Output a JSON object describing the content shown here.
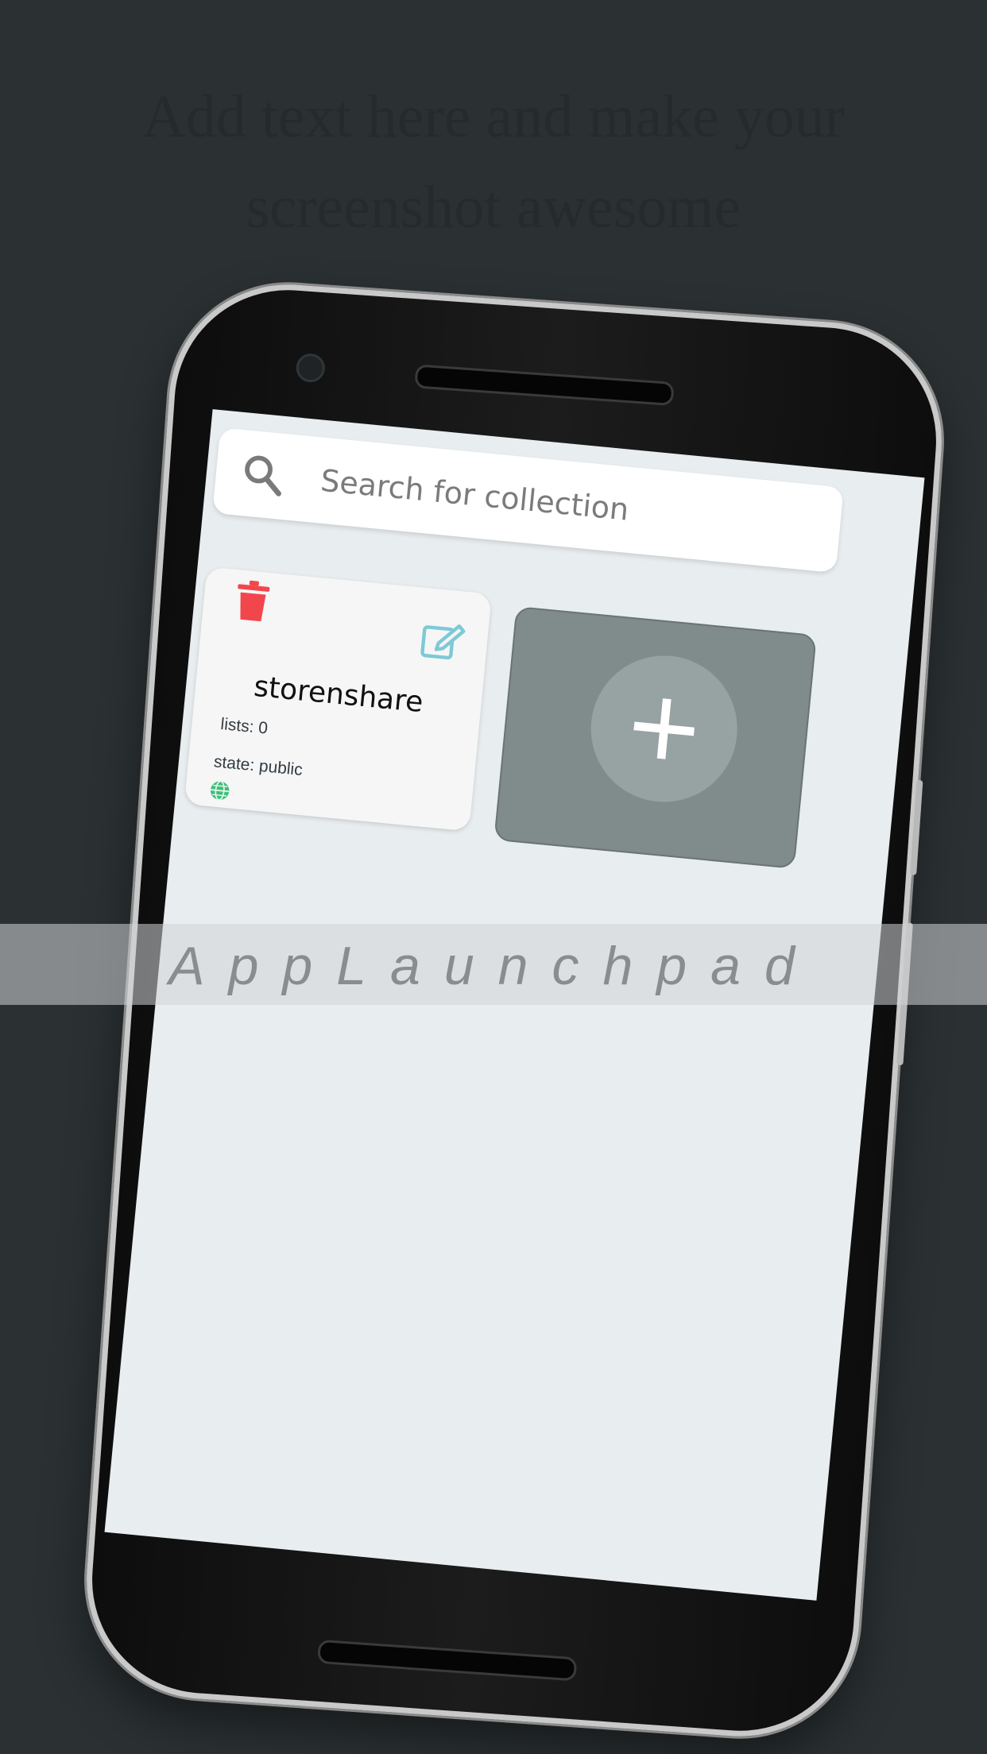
{
  "headline": {
    "line1": "Add text here and make your",
    "line2": "screenshot awesome"
  },
  "search": {
    "placeholder": "Search for collection",
    "icon": "search-icon"
  },
  "collections": [
    {
      "title": "storenshare",
      "lists": "lists: 0",
      "state": "state: public",
      "icons": [
        "trash-icon",
        "edit-icon",
        "globe-icon"
      ]
    }
  ],
  "add_tile": {
    "icon": "plus-icon"
  },
  "banner": {
    "text": "AppLaunchpad"
  },
  "colors": {
    "background": "#2b3133",
    "screen": "#e8edef",
    "trash": "#f2464d",
    "edit": "#7ec9d6",
    "globe": "#3fbf7a",
    "add_tile": "#808b8b"
  }
}
